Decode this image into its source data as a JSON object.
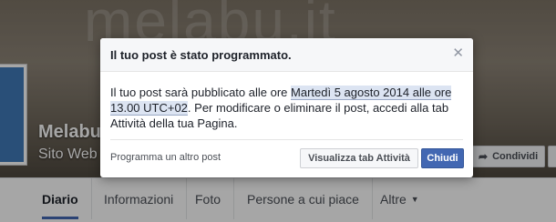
{
  "page": {
    "name": "Melabu",
    "category": "Sito Web",
    "cover_watermark": "melabu.it"
  },
  "header_actions": {
    "share_label": "Condividi",
    "share_icon": "share-arrow-icon"
  },
  "tabs": [
    {
      "label": "Diario",
      "active": true
    },
    {
      "label": "Informazioni",
      "active": false
    },
    {
      "label": "Foto",
      "active": false
    },
    {
      "label": "Persone a cui piace",
      "active": false
    },
    {
      "label": "Altre",
      "active": false,
      "dropdown": true
    }
  ],
  "dialog": {
    "title": "Il tuo post è stato programmato.",
    "close_icon": "close-icon",
    "body_prefix": "Il tuo post sarà pubblicato alle ore ",
    "body_highlight": "Martedì 5 agosto 2014 alle ore 13.00 UTC+02",
    "body_suffix": ". Per modificare o eliminare il post, accedi alla tab Attività della tua Pagina.",
    "footer_link": "Programma un altro post",
    "secondary_button": "Visualizza tab Attività",
    "primary_button": "Chiudi"
  },
  "colors": {
    "accent": "#4267b2",
    "overlay": "rgba(0,0,0,0.35)"
  }
}
